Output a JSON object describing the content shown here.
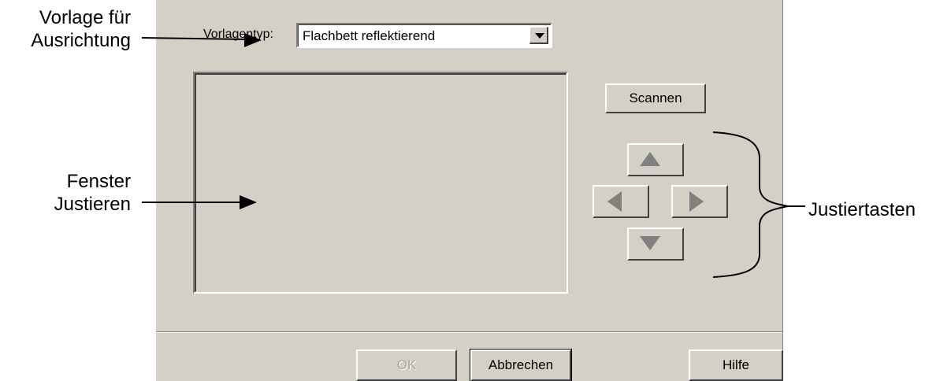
{
  "callouts": {
    "template_orientation": [
      "Vorlage für",
      "Ausrichtung"
    ],
    "adjust_window": [
      "Fenster",
      "Justieren"
    ],
    "adjust_keys": "Justiertasten"
  },
  "dialog": {
    "template_type_label": "Vorlagentyp:",
    "template_type_value": "Flachbett reflektierend",
    "scan_button": "Scannen",
    "ok_button": "OK",
    "cancel_button": "Abbrechen",
    "help_button": "Hilfe"
  },
  "icons": {
    "select_arrow": "chevron-down-icon",
    "up": "arrow-up-icon",
    "left": "arrow-left-icon",
    "right": "arrow-right-icon",
    "down": "arrow-down-icon"
  },
  "colors": {
    "dialog_bg": "#d4d0c8",
    "arrow_glyph": "#808080",
    "disabled_text": "#a8a5a0"
  }
}
